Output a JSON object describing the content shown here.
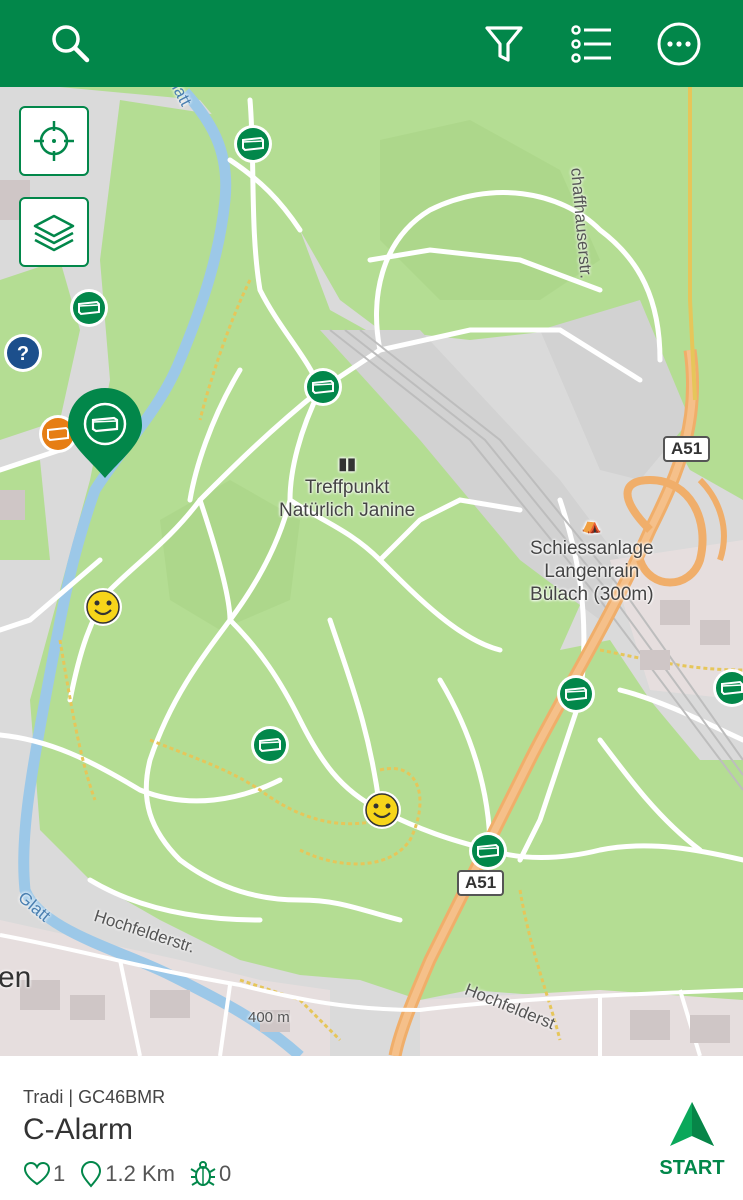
{
  "toolbar": {
    "search": "search-icon",
    "filter": "filter-icon",
    "list": "list-icon",
    "more": "more-icon",
    "color": "#02874a"
  },
  "map": {
    "places": {
      "meeting_line1": "Treffpunkt",
      "meeting_line2": "Natürlich Janine",
      "range_line1": "Schiessanlage",
      "range_line2": "Langenrain",
      "range_line3": "Bülach (300m)"
    },
    "highway": "A51",
    "roads": {
      "schaffhauser": "chaffhauserstr.",
      "hochfelder_left": "Hochfelderstr.",
      "hochfelder_right": "Hochfelderst"
    },
    "river_top": "latt",
    "river_bottom": "Glatt",
    "contour": "400 m",
    "edge_text": "en"
  },
  "cache": {
    "type": "Tradi",
    "code": "GC46BMR",
    "separator": "|",
    "name": "C-Alarm",
    "favorites": "1",
    "distance": "1.2 Km",
    "bugs": "0"
  },
  "action": {
    "start_label": "START"
  }
}
